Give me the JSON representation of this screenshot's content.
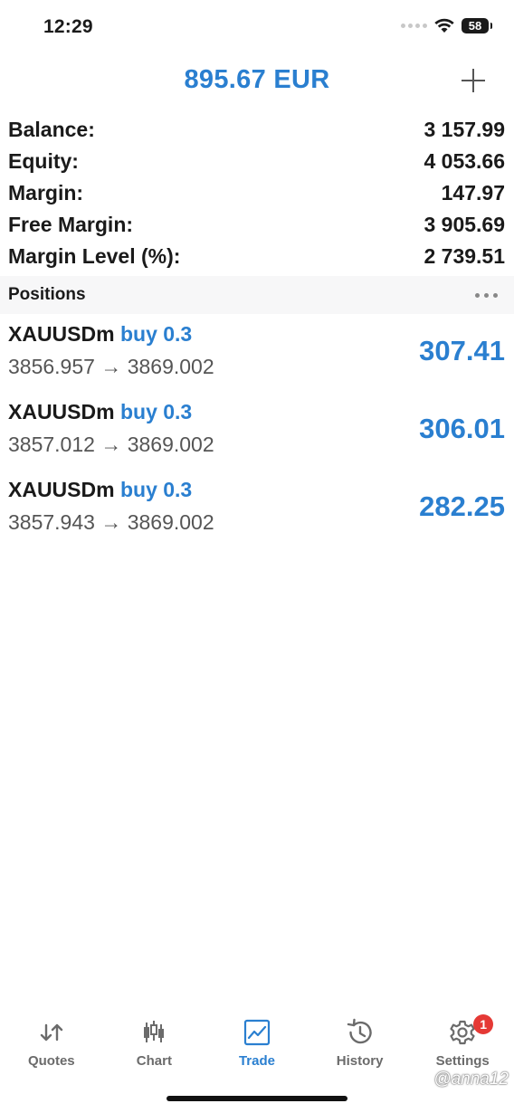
{
  "status_bar": {
    "time": "12:29",
    "battery": "58",
    "icons": [
      "signal-icon",
      "wifi-icon",
      "battery-icon"
    ]
  },
  "header": {
    "title": "895.67 EUR",
    "add_icon": "plus-icon"
  },
  "summary": [
    {
      "label": "Balance:",
      "value": "3 157.99"
    },
    {
      "label": "Equity:",
      "value": "4 053.66"
    },
    {
      "label": "Margin:",
      "value": "147.97"
    },
    {
      "label": "Free Margin:",
      "value": "3 905.69"
    },
    {
      "label": "Margin Level (%):",
      "value": "2 739.51"
    }
  ],
  "positions": {
    "title": "Positions",
    "more_icon": "more-horizontal-icon",
    "items": [
      {
        "symbol": "XAUUSDm",
        "side": "buy 0.3",
        "prices": "3856.957 → 3869.002",
        "profit": "307.41"
      },
      {
        "symbol": "XAUUSDm",
        "side": "buy 0.3",
        "prices": "3857.012 → 3869.002",
        "profit": "306.01"
      },
      {
        "symbol": "XAUUSDm",
        "side": "buy 0.3",
        "prices": "3857.943 → 3869.002",
        "profit": "282.25"
      }
    ]
  },
  "tab_bar": {
    "tabs": [
      {
        "label": "Quotes",
        "icon": "quotes-arrows-icon"
      },
      {
        "label": "Chart",
        "icon": "candlestick-icon"
      },
      {
        "label": "Trade",
        "icon": "trade-chart-icon",
        "active": true
      },
      {
        "label": "History",
        "icon": "history-clock-icon"
      },
      {
        "label": "Settings",
        "icon": "gear-icon",
        "badge": "1"
      }
    ]
  },
  "watermark": "@anna12",
  "colors": {
    "accent": "#2a7fd0",
    "badge": "#e53935",
    "text": "#1a1a1a"
  }
}
